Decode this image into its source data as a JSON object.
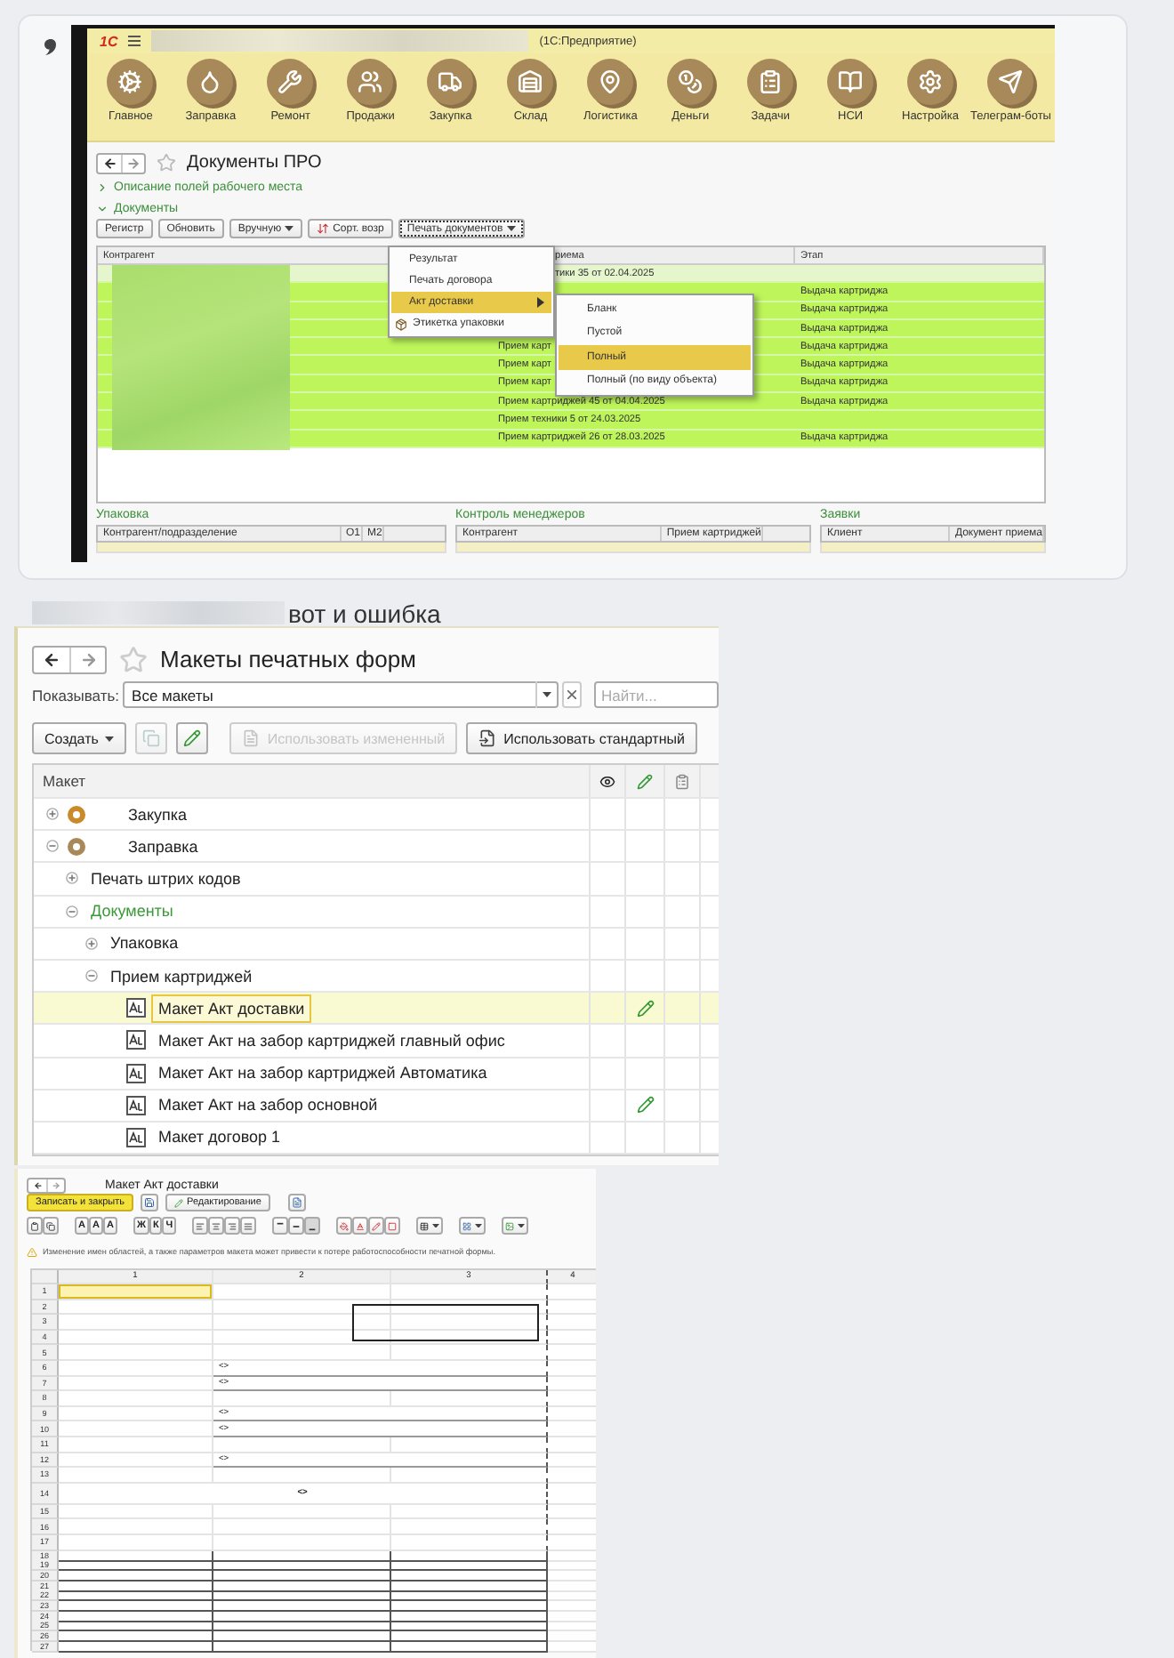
{
  "post_1": {
    "app_window": {
      "logo": "1С",
      "title": "(1С:Предприятие)",
      "sections": [
        {
          "label": "Главное"
        },
        {
          "label": "Заправка"
        },
        {
          "label": "Ремонт"
        },
        {
          "label": "Продажи"
        },
        {
          "label": "Закупка"
        },
        {
          "label": "Склад"
        },
        {
          "label": "Логистика"
        },
        {
          "label": "Деньги"
        },
        {
          "label": "Задачи"
        },
        {
          "label": "НСИ"
        },
        {
          "label": "Настройка"
        },
        {
          "label": "Телеграм-боты"
        }
      ],
      "page_title": "Документы ПРО",
      "groups": [
        {
          "label": "Описание полей рабочего места",
          "expanded": false
        },
        {
          "label": "Документы",
          "expanded": true
        }
      ],
      "buttons": [
        {
          "label": "Регистр",
          "kind": "plain",
          "selected": false
        },
        {
          "label": "Обновить",
          "kind": "plain",
          "selected": false
        },
        {
          "label": "Вручную",
          "kind": "dropdown",
          "selected": false
        },
        {
          "label": "Сорт. возр",
          "kind": "sort",
          "selected": false
        },
        {
          "label": "Печать документов",
          "kind": "dropdown",
          "selected": true
        }
      ],
      "table": {
        "columns": [
          {
            "label": "Контрагент"
          },
          {
            "label": "риема",
            "covered": true
          },
          {
            "label": "Этап"
          }
        ],
        "rows": [
          {
            "document": "тики 35 от 02.04.2025",
            "covered": true,
            "selected": true
          },
          {
            "stage": "Выдача картриджа",
            "selected": false
          },
          {
            "stage": "Выдача картриджа",
            "selected": false
          },
          {
            "stage": "Выдача картриджа",
            "selected": false
          },
          {
            "document": "Прием карт",
            "stage": "Выдача картриджа",
            "covered": false,
            "selected": false
          },
          {
            "document": "Прием карт",
            "stage": "Выдача картриджа",
            "covered": false,
            "selected": false
          },
          {
            "document": "Прием карт",
            "stage": "Выдача картриджа",
            "covered": false,
            "selected": false
          },
          {
            "document": "Прием картриджей 45 от 04.04.2025",
            "stage": "Выдача картриджа",
            "covered": false,
            "selected": false
          },
          {
            "document": "Прием техники 5 от 24.03.2025",
            "covered": false,
            "selected": false
          },
          {
            "document": "Прием картриджей 26 от 28.03.2025",
            "stage": "Выдача картриджа",
            "covered": false,
            "selected": false
          }
        ]
      },
      "print_menu": [
        {
          "label": "Результат",
          "kind": "plain",
          "selected": false
        },
        {
          "label": "Печать договора",
          "kind": "plain",
          "selected": false
        },
        {
          "label": "Акт доставки",
          "kind": "submenu",
          "selected": true
        },
        {
          "label": "Этикетка упаковки",
          "kind": "icon",
          "selected": false
        }
      ],
      "submenu": [
        {
          "label": "Бланк",
          "selected": false
        },
        {
          "label": "Пустой",
          "selected": false
        },
        {
          "label": "Полный",
          "selected": true
        },
        {
          "label": "Полный (по виду объекта)",
          "selected": false
        }
      ],
      "panels": [
        {
          "title": "Упаковка",
          "columns": [
            "Контрагент/подразделение",
            "О1",
            "М2"
          ]
        },
        {
          "title": "Контроль менеджеров",
          "columns": [
            "Контрагент",
            "Прием картриджей"
          ]
        },
        {
          "title": "Заявки",
          "columns": [
            "Клиент",
            "Документ приема"
          ]
        }
      ]
    }
  },
  "post_2": {
    "caption": "вот и ошибка",
    "templates_window": {
      "page_title": "Макеты печатных форм",
      "filter_label": "Показывать:",
      "filter_value": "Все макеты",
      "search": {
        "placeholder": "Найти..."
      },
      "toolbar": [
        {
          "label": "Создать",
          "kind": "dropdown",
          "disabled": false
        },
        {
          "kind": "copy",
          "disabled": true
        },
        {
          "kind": "edit",
          "disabled": false
        },
        {
          "label": "Использовать измененный",
          "kind": "changed",
          "disabled": true
        },
        {
          "label": "Использовать стандартный",
          "kind": "standard",
          "disabled": false
        }
      ],
      "column_header": "Макет",
      "tree": [
        {
          "label": "Закупка",
          "kind": "subsystem",
          "expanded": false,
          "selected": false
        },
        {
          "label": "Заправка",
          "kind": "subsystem",
          "expanded": true,
          "selected": false,
          "children": [
            {
              "label": "Печать штрих кодов",
              "kind": "group",
              "expanded": false,
              "selected": false
            },
            {
              "label": "Документы",
              "kind": "object_type",
              "expanded": true,
              "selected": false,
              "children": [
                {
                  "label": "Упаковка",
                  "kind": "group",
                  "expanded": false,
                  "selected": false
                },
                {
                  "label": "Прием картриджей",
                  "kind": "group",
                  "expanded": true,
                  "selected": false,
                  "children": [
                    {
                      "label": "Макет Акт доставки",
                      "kind": "template",
                      "selected": true,
                      "modified": true
                    },
                    {
                      "label": "Макет Акт на забор картриджей  главный офис",
                      "kind": "template",
                      "selected": false,
                      "modified": false
                    },
                    {
                      "label": "Макет Акт на забор картриджей Автоматика",
                      "kind": "template",
                      "selected": false,
                      "modified": false
                    },
                    {
                      "label": "Макет Акт на забор основной",
                      "kind": "template",
                      "selected": false,
                      "modified": true
                    },
                    {
                      "label": "Макет договор 1",
                      "kind": "template",
                      "selected": false,
                      "modified": false
                    }
                  ]
                }
              ]
            }
          ]
        }
      ]
    },
    "editor_window": {
      "page_title": "Макет Акт доставки",
      "save_button": "Записать и закрыть",
      "mode_button": "Редактирование",
      "format_toolbar": [
        {
          "items": [
            {
              "kind": "paste",
              "pressed": false
            },
            {
              "kind": "copy",
              "pressed": false
            }
          ]
        },
        {
          "items": [
            {
              "kind": "glyph",
              "label": "А",
              "pressed": false
            },
            {
              "kind": "glyph",
              "label": "А",
              "pressed": false
            },
            {
              "kind": "glyph",
              "label": "А",
              "pressed": false
            }
          ]
        },
        {
          "items": [
            {
              "kind": "glyph",
              "label": "Ж",
              "pressed": false
            },
            {
              "kind": "glyph",
              "label": "К",
              "pressed": false
            },
            {
              "kind": "glyph",
              "label": "Ч",
              "pressed": false
            }
          ]
        },
        {
          "items": [
            {
              "kind": "align_left",
              "pressed": false
            },
            {
              "kind": "align_center",
              "pressed": false
            },
            {
              "kind": "align_right",
              "pressed": false
            },
            {
              "kind": "align_justify",
              "pressed": false
            }
          ]
        },
        {
          "items": [
            {
              "kind": "valign_top",
              "pressed": false
            },
            {
              "kind": "valign_middle",
              "pressed": false
            },
            {
              "kind": "valign_bottom",
              "pressed": true
            }
          ]
        },
        {
          "items": [
            {
              "kind": "fill",
              "pressed": false
            },
            {
              "kind": "text_color",
              "pressed": false
            },
            {
              "kind": "pencil",
              "pressed": false
            },
            {
              "kind": "border_color",
              "pressed": false
            }
          ]
        },
        {
          "items": [
            {
              "kind": "borders_menu",
              "pressed": false
            }
          ]
        },
        {
          "items": [
            {
              "kind": "layout_menu",
              "pressed": false
            }
          ]
        },
        {
          "items": [
            {
              "kind": "picture_menu",
              "pressed": false
            }
          ]
        }
      ],
      "warning": "Изменение имен областей, а также параметров макета может привести к потере работоспособности печатной формы.",
      "sheet": {
        "columns": [
          "1",
          "2",
          "3",
          "4"
        ],
        "rows": [
          {
            "number": "1",
            "kind": "plain",
            "selected": true
          },
          {
            "number": "2",
            "kind": "boxed",
            "selected": false
          },
          {
            "number": "3",
            "kind": "boxed",
            "selected": false
          },
          {
            "number": "4",
            "kind": "boxed",
            "selected": false
          },
          {
            "number": "5",
            "kind": "plain",
            "selected": false
          },
          {
            "number": "6",
            "kind": "param",
            "text": "<>",
            "selected": false
          },
          {
            "number": "7",
            "kind": "param",
            "text": "<>",
            "selected": false
          },
          {
            "number": "8",
            "kind": "plain",
            "selected": false
          },
          {
            "number": "9",
            "kind": "param",
            "text": "<>",
            "selected": false
          },
          {
            "number": "10",
            "kind": "param",
            "text": "<>",
            "selected": false
          },
          {
            "number": "11",
            "kind": "plain",
            "selected": false
          },
          {
            "number": "12",
            "kind": "param",
            "text": "<>",
            "selected": false
          },
          {
            "number": "13",
            "kind": "plain",
            "selected": false
          },
          {
            "number": "14",
            "kind": "center",
            "text": "<>",
            "selected": false
          },
          {
            "number": "15",
            "kind": "plain",
            "selected": false
          },
          {
            "number": "16",
            "kind": "plain",
            "selected": false
          },
          {
            "number": "17",
            "kind": "plain",
            "selected": false
          },
          {
            "number": "18",
            "kind": "grid",
            "selected": false
          },
          {
            "number": "19",
            "kind": "grid",
            "selected": false
          },
          {
            "number": "20",
            "kind": "grid",
            "selected": false
          },
          {
            "number": "21",
            "kind": "grid",
            "selected": false
          },
          {
            "number": "22",
            "kind": "grid",
            "selected": false
          },
          {
            "number": "23",
            "kind": "grid",
            "selected": false
          },
          {
            "number": "24",
            "kind": "grid",
            "selected": false
          },
          {
            "number": "25",
            "kind": "grid",
            "selected": false
          },
          {
            "number": "26",
            "kind": "grid",
            "selected": false
          },
          {
            "number": "27",
            "kind": "grid",
            "selected": false
          }
        ]
      }
    }
  }
}
